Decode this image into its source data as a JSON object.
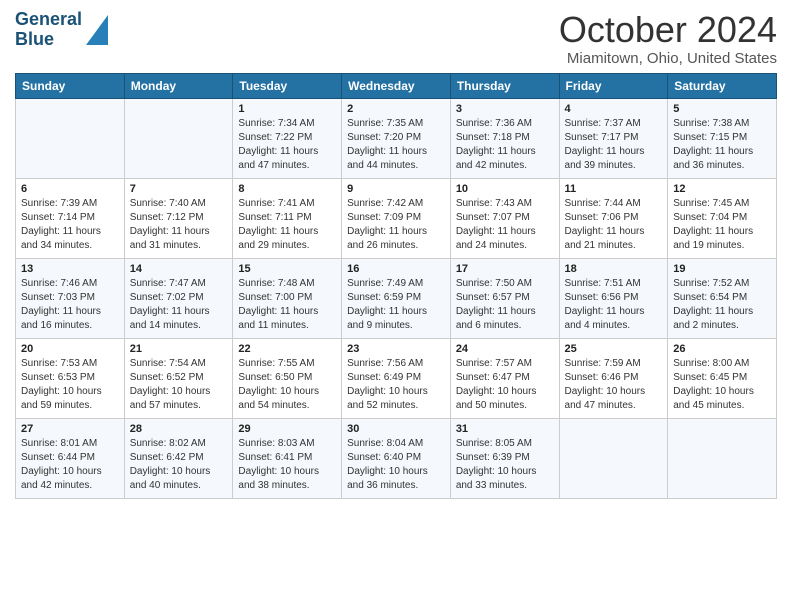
{
  "header": {
    "logo_line1": "General",
    "logo_line2": "Blue",
    "month": "October 2024",
    "location": "Miamitown, Ohio, United States"
  },
  "days_of_week": [
    "Sunday",
    "Monday",
    "Tuesday",
    "Wednesday",
    "Thursday",
    "Friday",
    "Saturday"
  ],
  "weeks": [
    [
      {
        "day": "",
        "data": ""
      },
      {
        "day": "",
        "data": ""
      },
      {
        "day": "1",
        "data": "Sunrise: 7:34 AM\nSunset: 7:22 PM\nDaylight: 11 hours and 47 minutes."
      },
      {
        "day": "2",
        "data": "Sunrise: 7:35 AM\nSunset: 7:20 PM\nDaylight: 11 hours and 44 minutes."
      },
      {
        "day": "3",
        "data": "Sunrise: 7:36 AM\nSunset: 7:18 PM\nDaylight: 11 hours and 42 minutes."
      },
      {
        "day": "4",
        "data": "Sunrise: 7:37 AM\nSunset: 7:17 PM\nDaylight: 11 hours and 39 minutes."
      },
      {
        "day": "5",
        "data": "Sunrise: 7:38 AM\nSunset: 7:15 PM\nDaylight: 11 hours and 36 minutes."
      }
    ],
    [
      {
        "day": "6",
        "data": "Sunrise: 7:39 AM\nSunset: 7:14 PM\nDaylight: 11 hours and 34 minutes."
      },
      {
        "day": "7",
        "data": "Sunrise: 7:40 AM\nSunset: 7:12 PM\nDaylight: 11 hours and 31 minutes."
      },
      {
        "day": "8",
        "data": "Sunrise: 7:41 AM\nSunset: 7:11 PM\nDaylight: 11 hours and 29 minutes."
      },
      {
        "day": "9",
        "data": "Sunrise: 7:42 AM\nSunset: 7:09 PM\nDaylight: 11 hours and 26 minutes."
      },
      {
        "day": "10",
        "data": "Sunrise: 7:43 AM\nSunset: 7:07 PM\nDaylight: 11 hours and 24 minutes."
      },
      {
        "day": "11",
        "data": "Sunrise: 7:44 AM\nSunset: 7:06 PM\nDaylight: 11 hours and 21 minutes."
      },
      {
        "day": "12",
        "data": "Sunrise: 7:45 AM\nSunset: 7:04 PM\nDaylight: 11 hours and 19 minutes."
      }
    ],
    [
      {
        "day": "13",
        "data": "Sunrise: 7:46 AM\nSunset: 7:03 PM\nDaylight: 11 hours and 16 minutes."
      },
      {
        "day": "14",
        "data": "Sunrise: 7:47 AM\nSunset: 7:02 PM\nDaylight: 11 hours and 14 minutes."
      },
      {
        "day": "15",
        "data": "Sunrise: 7:48 AM\nSunset: 7:00 PM\nDaylight: 11 hours and 11 minutes."
      },
      {
        "day": "16",
        "data": "Sunrise: 7:49 AM\nSunset: 6:59 PM\nDaylight: 11 hours and 9 minutes."
      },
      {
        "day": "17",
        "data": "Sunrise: 7:50 AM\nSunset: 6:57 PM\nDaylight: 11 hours and 6 minutes."
      },
      {
        "day": "18",
        "data": "Sunrise: 7:51 AM\nSunset: 6:56 PM\nDaylight: 11 hours and 4 minutes."
      },
      {
        "day": "19",
        "data": "Sunrise: 7:52 AM\nSunset: 6:54 PM\nDaylight: 11 hours and 2 minutes."
      }
    ],
    [
      {
        "day": "20",
        "data": "Sunrise: 7:53 AM\nSunset: 6:53 PM\nDaylight: 10 hours and 59 minutes."
      },
      {
        "day": "21",
        "data": "Sunrise: 7:54 AM\nSunset: 6:52 PM\nDaylight: 10 hours and 57 minutes."
      },
      {
        "day": "22",
        "data": "Sunrise: 7:55 AM\nSunset: 6:50 PM\nDaylight: 10 hours and 54 minutes."
      },
      {
        "day": "23",
        "data": "Sunrise: 7:56 AM\nSunset: 6:49 PM\nDaylight: 10 hours and 52 minutes."
      },
      {
        "day": "24",
        "data": "Sunrise: 7:57 AM\nSunset: 6:47 PM\nDaylight: 10 hours and 50 minutes."
      },
      {
        "day": "25",
        "data": "Sunrise: 7:59 AM\nSunset: 6:46 PM\nDaylight: 10 hours and 47 minutes."
      },
      {
        "day": "26",
        "data": "Sunrise: 8:00 AM\nSunset: 6:45 PM\nDaylight: 10 hours and 45 minutes."
      }
    ],
    [
      {
        "day": "27",
        "data": "Sunrise: 8:01 AM\nSunset: 6:44 PM\nDaylight: 10 hours and 42 minutes."
      },
      {
        "day": "28",
        "data": "Sunrise: 8:02 AM\nSunset: 6:42 PM\nDaylight: 10 hours and 40 minutes."
      },
      {
        "day": "29",
        "data": "Sunrise: 8:03 AM\nSunset: 6:41 PM\nDaylight: 10 hours and 38 minutes."
      },
      {
        "day": "30",
        "data": "Sunrise: 8:04 AM\nSunset: 6:40 PM\nDaylight: 10 hours and 36 minutes."
      },
      {
        "day": "31",
        "data": "Sunrise: 8:05 AM\nSunset: 6:39 PM\nDaylight: 10 hours and 33 minutes."
      },
      {
        "day": "",
        "data": ""
      },
      {
        "day": "",
        "data": ""
      }
    ]
  ]
}
